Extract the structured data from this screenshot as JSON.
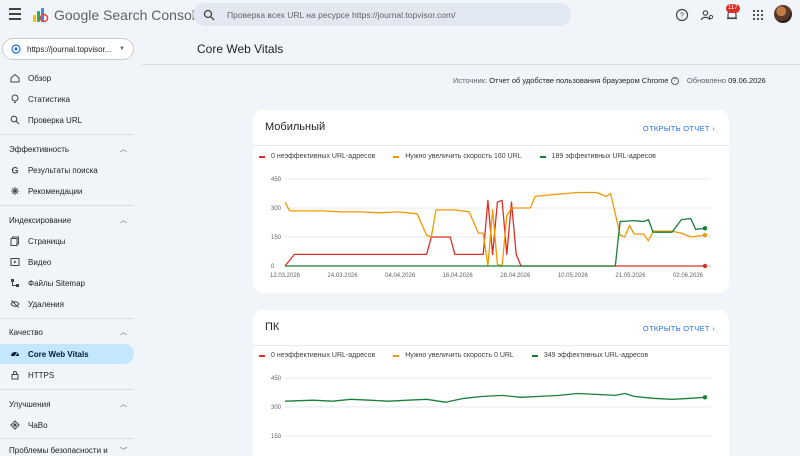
{
  "app": {
    "title": "Google Search Console"
  },
  "search": {
    "placeholder": "Проверка всех URL на ресурсе https://journal.topvisor.com/"
  },
  "header": {
    "notifications_count": "117"
  },
  "sidebar": {
    "property": "https://journal.topvisor...",
    "top_items": [
      {
        "label": "Обзор",
        "icon": "home-icon"
      },
      {
        "label": "Статистика",
        "icon": "bulb-icon"
      },
      {
        "label": "Проверка URL",
        "icon": "search-icon"
      }
    ],
    "sections": [
      {
        "label": "Эффективность",
        "items": [
          {
            "label": "Результаты поиска",
            "icon": "google-g-icon"
          },
          {
            "label": "Рекомендации",
            "icon": "sparkle-icon"
          }
        ]
      },
      {
        "label": "Индексирование",
        "items": [
          {
            "label": "Страницы",
            "icon": "pages-icon"
          },
          {
            "label": "Видео",
            "icon": "video-icon"
          },
          {
            "label": "Файлы Sitemap",
            "icon": "sitemap-icon"
          },
          {
            "label": "Удаления",
            "icon": "eye-off-icon"
          }
        ]
      },
      {
        "label": "Качество",
        "items": [
          {
            "label": "Core Web Vitals",
            "icon": "speedometer-icon",
            "active": true
          },
          {
            "label": "HTTPS",
            "icon": "lock-icon"
          }
        ]
      },
      {
        "label": "Улучшения",
        "items": [
          {
            "label": "ЧаВо",
            "icon": "diamond-icon"
          }
        ]
      },
      {
        "label": "Проблемы безопасности и",
        "items": []
      }
    ]
  },
  "main": {
    "title": "Core Web Vitals",
    "source_label": "Источник:",
    "source_value": "Отчет об удобстве пользования браузером Chrome",
    "updated_label": "Обновлено",
    "updated_value": "09.06.2026",
    "open_report": "ОТКРЫТЬ ОТЧЕТ"
  },
  "colors": {
    "poor": "#d93025",
    "needs": "#f29900",
    "good": "#188038",
    "link": "#1a73e8",
    "active_nav": "#c2e7ff"
  },
  "chart_data": [
    {
      "type": "line",
      "title": "Мобильный",
      "legend": [
        "0 неэффективных URL-адресов",
        "Нужно увеличить скорость 160 URL",
        "189 эффективных URL-адресов"
      ],
      "yticks": [
        0,
        150,
        300,
        450
      ],
      "ylim": [
        0,
        450
      ],
      "xticks": [
        "12.03.2026",
        "24.03.2026",
        "04.04.2026",
        "16.04.2026",
        "28.04.2026",
        "10.05.2026",
        "21.05.2026",
        "02.06.2026"
      ],
      "x_count": 90,
      "series": [
        {
          "name": "0 неэффективных URL-адресов",
          "color": "#d93025",
          "points": [
            [
              0,
              0
            ],
            [
              2,
              60
            ],
            [
              30,
              60
            ],
            [
              31,
              150
            ],
            [
              35,
              150
            ],
            [
              36,
              60
            ],
            [
              42,
              60
            ],
            [
              43,
              340
            ],
            [
              44,
              60
            ],
            [
              45,
              330
            ],
            [
              46,
              340
            ],
            [
              47,
              60
            ],
            [
              48,
              330
            ],
            [
              49,
              60
            ],
            [
              50,
              0
            ],
            [
              89,
              0
            ]
          ]
        },
        {
          "name": "Нужно увеличить скорость 160 URL",
          "color": "#f29900",
          "points": [
            [
              0,
              330
            ],
            [
              1,
              285
            ],
            [
              8,
              285
            ],
            [
              12,
              280
            ],
            [
              16,
              280
            ],
            [
              20,
              275
            ],
            [
              24,
              280
            ],
            [
              28,
              270
            ],
            [
              30,
              160
            ],
            [
              31,
              150
            ],
            [
              32,
              290
            ],
            [
              36,
              290
            ],
            [
              39,
              280
            ],
            [
              41,
              170
            ],
            [
              42,
              170
            ],
            [
              43,
              0
            ],
            [
              44,
              290
            ],
            [
              45,
              10
            ],
            [
              46,
              0
            ],
            [
              47,
              260
            ],
            [
              48,
              300
            ],
            [
              52,
              300
            ],
            [
              53,
              360
            ],
            [
              57,
              370
            ],
            [
              62,
              380
            ],
            [
              66,
              380
            ],
            [
              68,
              360
            ],
            [
              69,
              375
            ],
            [
              70,
              270
            ],
            [
              71,
              160
            ],
            [
              72,
              150
            ],
            [
              73,
              210
            ],
            [
              74,
              165
            ],
            [
              76,
              165
            ],
            [
              77,
              130
            ],
            [
              78,
              180
            ],
            [
              82,
              180
            ],
            [
              84,
              170
            ],
            [
              86,
              150
            ],
            [
              89,
              160
            ]
          ]
        },
        {
          "name": "189 эффективных URL-адресов",
          "color": "#188038",
          "points": [
            [
              0,
              0
            ],
            [
              70,
              0
            ],
            [
              71,
              230
            ],
            [
              74,
              235
            ],
            [
              76,
              230
            ],
            [
              77,
              240
            ],
            [
              78,
              175
            ],
            [
              82,
              175
            ],
            [
              84,
              240
            ],
            [
              86,
              245
            ],
            [
              87,
              190
            ],
            [
              89,
              195
            ]
          ]
        }
      ]
    },
    {
      "type": "line",
      "title": "ПК",
      "legend": [
        "0 неэффективных URL-адресов",
        "Нужно увеличить скорость 0 URL",
        "349 эффективных URL-адресов"
      ],
      "yticks": [
        150,
        300,
        450
      ],
      "ylim": [
        0,
        450
      ],
      "x_count": 90,
      "series": [
        {
          "name": "349 эффективных URL-адресов",
          "color": "#188038",
          "points": [
            [
              0,
              330
            ],
            [
              6,
              335
            ],
            [
              10,
              330
            ],
            [
              14,
              340
            ],
            [
              18,
              335
            ],
            [
              22,
              330
            ],
            [
              26,
              335
            ],
            [
              30,
              340
            ],
            [
              34,
              325
            ],
            [
              38,
              345
            ],
            [
              42,
              355
            ],
            [
              46,
              360
            ],
            [
              50,
              350
            ],
            [
              54,
              355
            ],
            [
              58,
              360
            ],
            [
              62,
              370
            ],
            [
              66,
              365
            ],
            [
              70,
              360
            ],
            [
              72,
              370
            ],
            [
              74,
              355
            ],
            [
              78,
              345
            ],
            [
              82,
              340
            ],
            [
              86,
              345
            ],
            [
              89,
              350
            ]
          ]
        }
      ]
    }
  ]
}
